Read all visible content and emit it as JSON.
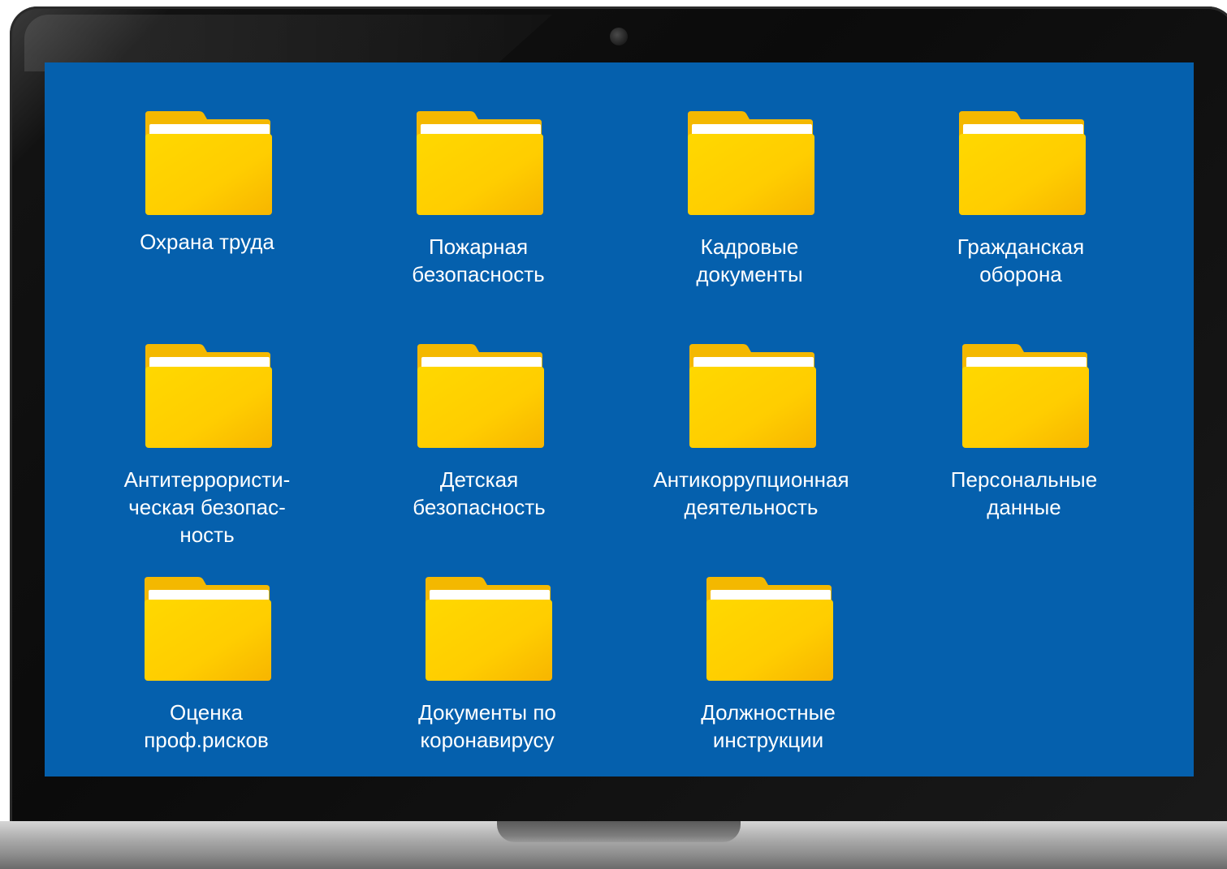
{
  "desktop": {
    "folders": [
      {
        "label": "Охрана труда",
        "icon": "folder-icon"
      },
      {
        "label": "Пожарная\nбезопасность",
        "icon": "folder-icon"
      },
      {
        "label": "Кадровые\nдокументы",
        "icon": "folder-icon"
      },
      {
        "label": "Гражданская\nоборона",
        "icon": "folder-icon"
      },
      {
        "label": "Антитеррористи-\nческая безопас-\nность",
        "icon": "folder-icon"
      },
      {
        "label": "Детская\nбезопасность",
        "icon": "folder-icon"
      },
      {
        "label": "Антикоррупционная\nдеятельность",
        "icon": "folder-icon"
      },
      {
        "label": "Персональные\nданные",
        "icon": "folder-icon"
      },
      {
        "label": "Оценка\nпроф.рисков",
        "icon": "folder-icon"
      },
      {
        "label": "Документы по\nкоронавирусу",
        "icon": "folder-icon"
      },
      {
        "label": "Должностные\nинструкции",
        "icon": "folder-icon"
      }
    ]
  },
  "colors": {
    "screen_background": "#0560ad",
    "folder_back": "#f4b800",
    "folder_front": "#ffd000",
    "folder_paper": "#ffffff",
    "label_text": "#ffffff",
    "bezel": "#0b0b0b"
  }
}
